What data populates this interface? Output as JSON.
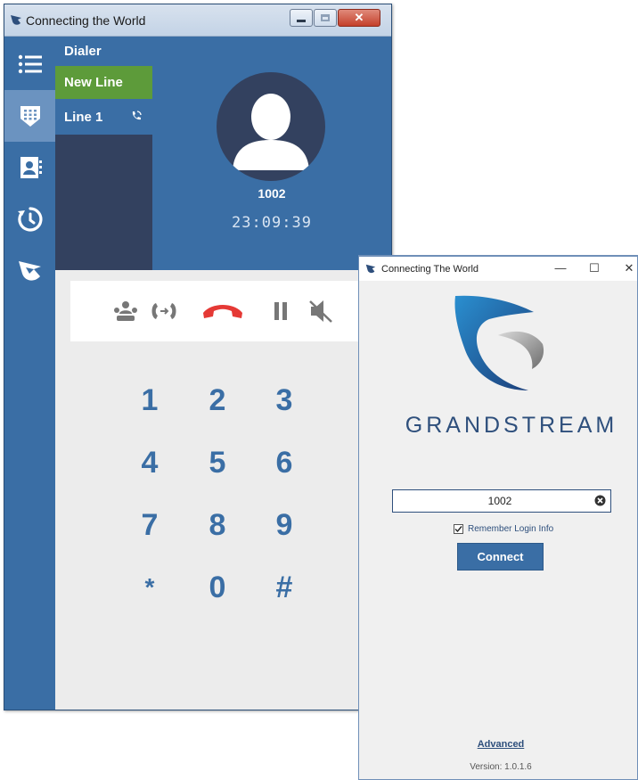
{
  "dialer_window": {
    "title": "Connecting the World",
    "sidebar": {
      "items": [
        {
          "icon": "menu-list-icon"
        },
        {
          "icon": "dialpad-icon",
          "active": true
        },
        {
          "icon": "contacts-icon"
        },
        {
          "icon": "history-clock-icon"
        },
        {
          "icon": "grandstream-logo-icon"
        }
      ]
    },
    "lines": {
      "header": "Dialer",
      "new_line": "New Line",
      "line1": "Line 1"
    },
    "call": {
      "number": "1002",
      "timer": "23:09:39"
    },
    "controls": [
      {
        "icon": "conference-phone-icon"
      },
      {
        "icon": "transfer-call-icon"
      },
      {
        "icon": "hang-up-icon",
        "color": "#e53935"
      },
      {
        "icon": "hold-pause-icon"
      },
      {
        "icon": "mute-speaker-icon"
      }
    ],
    "keypad": [
      "1",
      "2",
      "3",
      "4",
      "5",
      "6",
      "7",
      "8",
      "9",
      "*",
      "0",
      "#"
    ],
    "colors": {
      "primary": "#3a6ea5",
      "dark": "#33415f",
      "accent": "#5d9b3a"
    }
  },
  "login_window": {
    "title": "Connecting The World",
    "brand": "GRANDSTREAM",
    "account_value": "1002",
    "remember_label": "Remember Login Info",
    "remember_checked": true,
    "connect_label": "Connect",
    "advanced_label": "Advanced",
    "version": "Version: 1.0.1.6"
  }
}
